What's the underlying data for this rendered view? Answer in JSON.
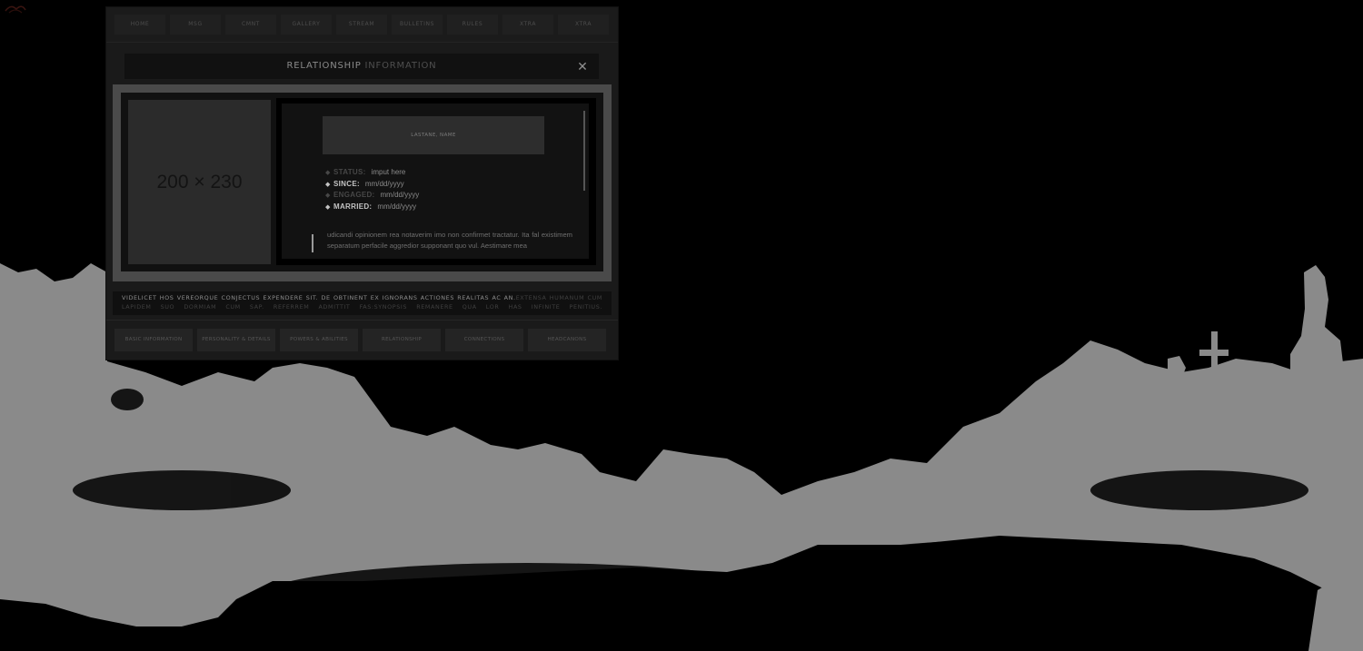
{
  "top_nav": {
    "items": [
      {
        "label": "HOME"
      },
      {
        "label": "MSG"
      },
      {
        "label": "CMNT"
      },
      {
        "label": "GALLERY"
      },
      {
        "label": "STREAM"
      },
      {
        "label": "BULLETINS"
      },
      {
        "label": "RULES"
      },
      {
        "label": "XTRA"
      },
      {
        "label": "XTRA"
      }
    ]
  },
  "panel": {
    "title_bold": "RELATIONSHIP",
    "title_light": "INFORMATION",
    "close_label": "✕"
  },
  "profile": {
    "photo_placeholder": "200 × 230",
    "name": "LASTANE, NAME",
    "facts": [
      {
        "label": "STATUS:",
        "value": "imput here"
      },
      {
        "label": "SINCE:",
        "value": "mm/dd/yyyy"
      },
      {
        "label": "ENGAGED:",
        "value": "mm/dd/yyyy"
      },
      {
        "label": "MARRIED:",
        "value": "mm/dd/yyyy"
      }
    ],
    "bullet": "◆",
    "bio": "udicandi opinionem rea notaverim imo non confirmet tractatur. Ita fal existimem separatum perfacile aggredior supponant quo vul. Aestimare mea"
  },
  "quote": {
    "part1": "VIDELICET HOS VEREORQUE CONJECTUS EXPENDERE SIT. DE OBTINENT EX IGNORANS ACTIONES REALITAS AC AN.",
    "part2": "EXTENSA HUMANUM CUM LAPIDEM SUO DORMIAM CUM SAP. REFERREM ADMITTIT FAS:SYNOPSIS REMANERE QUA LOR HAS INFINITE PENITIUS."
  },
  "bottom_nav": {
    "tabs": [
      {
        "label": "BASIC INFORMATION"
      },
      {
        "label": "PERSONALITY & DETAILS"
      },
      {
        "label": "POWERS & ABILITIES"
      },
      {
        "label": "RELATIONSHIP"
      },
      {
        "label": "CONNECTIONS"
      },
      {
        "label": "HEADCANONS"
      }
    ]
  },
  "colors": {
    "background": "#000000",
    "window": "#1a1a1a",
    "landscape": "#8a8a8a"
  }
}
